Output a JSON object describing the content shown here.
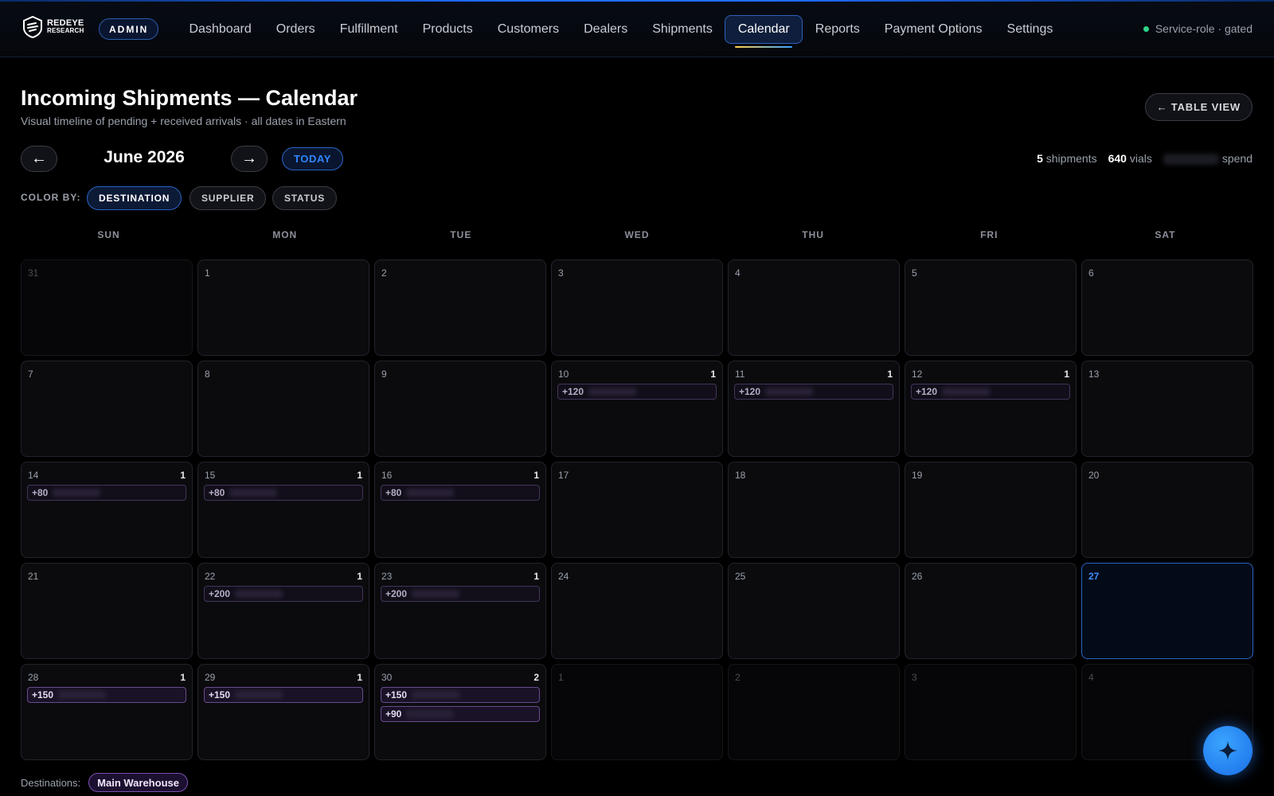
{
  "header": {
    "logo_line1": "REDEYE",
    "logo_line2": "RESEARCH",
    "admin_badge": "ADMIN",
    "nav": [
      {
        "label": "Dashboard",
        "active": false
      },
      {
        "label": "Orders",
        "active": false
      },
      {
        "label": "Fulfillment",
        "active": false
      },
      {
        "label": "Products",
        "active": false
      },
      {
        "label": "Customers",
        "active": false
      },
      {
        "label": "Dealers",
        "active": false
      },
      {
        "label": "Shipments",
        "active": false
      },
      {
        "label": "Calendar",
        "active": true
      },
      {
        "label": "Reports",
        "active": false
      },
      {
        "label": "Payment Options",
        "active": false
      },
      {
        "label": "Settings",
        "active": false
      }
    ],
    "service_status": "Service-role · gated"
  },
  "page": {
    "title": "Incoming Shipments — Calendar",
    "subtitle": "Visual timeline of pending + received arrivals · all dates in Eastern",
    "table_view_label": "← TABLE VIEW"
  },
  "month_nav": {
    "prev": "←",
    "next": "→",
    "month_label": "June 2026",
    "today_label": "TODAY"
  },
  "stats": {
    "shipments_count": "5",
    "shipments_label": "shipments",
    "vials_count": "640",
    "vials_label": "vials",
    "spend_label": "spend"
  },
  "color_by": {
    "label": "COLOR BY:",
    "options": [
      "DESTINATION",
      "SUPPLIER",
      "STATUS"
    ],
    "selected": "DESTINATION"
  },
  "weekdays": [
    "SUN",
    "MON",
    "TUE",
    "WED",
    "THU",
    "FRI",
    "SAT"
  ],
  "calendar": {
    "today": 27,
    "cells": [
      {
        "day": "31",
        "other": true,
        "count": "",
        "events": []
      },
      {
        "day": "1",
        "other": false,
        "count": "",
        "events": []
      },
      {
        "day": "2",
        "other": false,
        "count": "",
        "events": []
      },
      {
        "day": "3",
        "other": false,
        "count": "",
        "events": []
      },
      {
        "day": "4",
        "other": false,
        "count": "",
        "events": []
      },
      {
        "day": "5",
        "other": false,
        "count": "",
        "events": []
      },
      {
        "day": "6",
        "other": false,
        "count": "",
        "events": []
      },
      {
        "day": "7",
        "other": false,
        "count": "",
        "events": []
      },
      {
        "day": "8",
        "other": false,
        "count": "",
        "events": []
      },
      {
        "day": "9",
        "other": false,
        "count": "",
        "events": []
      },
      {
        "day": "10",
        "other": false,
        "count": "1",
        "events": [
          {
            "label": "+120",
            "faded": true
          }
        ]
      },
      {
        "day": "11",
        "other": false,
        "count": "1",
        "events": [
          {
            "label": "+120",
            "faded": true
          }
        ]
      },
      {
        "day": "12",
        "other": false,
        "count": "1",
        "events": [
          {
            "label": "+120",
            "faded": true
          }
        ]
      },
      {
        "day": "13",
        "other": false,
        "count": "",
        "events": []
      },
      {
        "day": "14",
        "other": false,
        "count": "1",
        "events": [
          {
            "label": "+80",
            "faded": true
          }
        ]
      },
      {
        "day": "15",
        "other": false,
        "count": "1",
        "events": [
          {
            "label": "+80",
            "faded": true
          }
        ]
      },
      {
        "day": "16",
        "other": false,
        "count": "1",
        "events": [
          {
            "label": "+80",
            "faded": true
          }
        ]
      },
      {
        "day": "17",
        "other": false,
        "count": "",
        "events": []
      },
      {
        "day": "18",
        "other": false,
        "count": "",
        "events": []
      },
      {
        "day": "19",
        "other": false,
        "count": "",
        "events": []
      },
      {
        "day": "20",
        "other": false,
        "count": "",
        "events": []
      },
      {
        "day": "21",
        "other": false,
        "count": "",
        "events": []
      },
      {
        "day": "22",
        "other": false,
        "count": "1",
        "events": [
          {
            "label": "+200",
            "faded": true
          }
        ]
      },
      {
        "day": "23",
        "other": false,
        "count": "1",
        "events": [
          {
            "label": "+200",
            "faded": true
          }
        ]
      },
      {
        "day": "24",
        "other": false,
        "count": "",
        "events": []
      },
      {
        "day": "25",
        "other": false,
        "count": "",
        "events": []
      },
      {
        "day": "26",
        "other": false,
        "count": "",
        "events": []
      },
      {
        "day": "27",
        "other": false,
        "count": "",
        "events": [],
        "today": true
      },
      {
        "day": "28",
        "other": false,
        "count": "1",
        "events": [
          {
            "label": "+150",
            "faded": false
          }
        ]
      },
      {
        "day": "29",
        "other": false,
        "count": "1",
        "events": [
          {
            "label": "+150",
            "faded": false
          }
        ]
      },
      {
        "day": "30",
        "other": false,
        "count": "2",
        "events": [
          {
            "label": "+150",
            "faded": false
          },
          {
            "label": "+90",
            "faded": false
          }
        ]
      },
      {
        "day": "1",
        "other": true,
        "count": "",
        "events": []
      },
      {
        "day": "2",
        "other": true,
        "count": "",
        "events": []
      },
      {
        "day": "3",
        "other": true,
        "count": "",
        "events": []
      },
      {
        "day": "4",
        "other": true,
        "count": "",
        "events": []
      }
    ]
  },
  "legend": {
    "label": "Destinations:",
    "items": [
      "Main Warehouse"
    ]
  },
  "colors": {
    "accent": "#2f86ff",
    "event_border": "#6a4a8e",
    "status_dot": "#2fd68a"
  },
  "icons": {
    "fab": "sparkle-icon"
  }
}
